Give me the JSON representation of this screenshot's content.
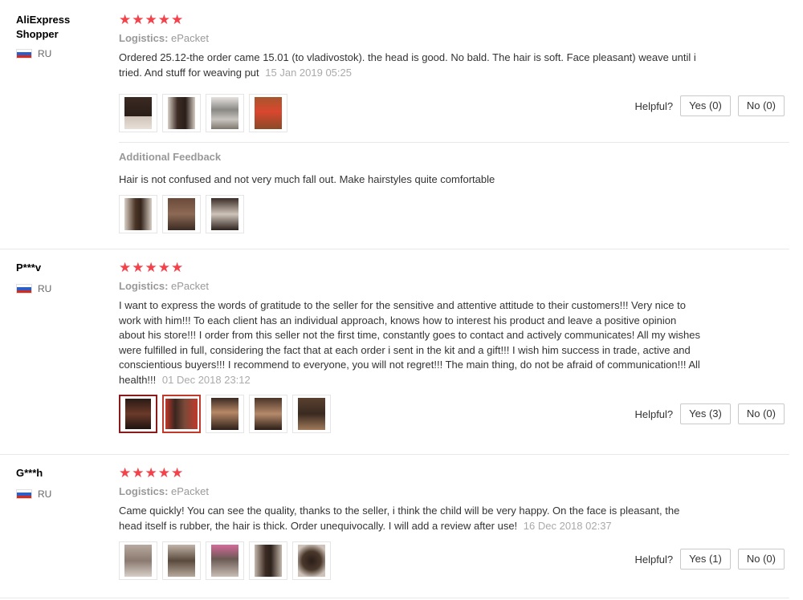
{
  "reviews": [
    {
      "user": "AliExpress\nShopper",
      "country": "RU",
      "stars": "★★★★★",
      "logistics_label": "Logistics:",
      "logistics_value": "ePacket",
      "text": "Ordered 25.12-the order came 15.01 (to vladivostok). the head is good. No bald. The hair is soft. Face pleasant) weave until i tried. And stuff for weaving put",
      "date": "15 Jan 2019 05:25",
      "helpful_label": "Helpful?",
      "yes": "Yes (0)",
      "no": "No (0)",
      "photo_count": 4,
      "additional": {
        "title": "Additional Feedback",
        "text": "Hair is not confused and not very much fall out. Make hairstyles quite comfortable",
        "photo_count": 3
      }
    },
    {
      "user": "P***v",
      "country": "RU",
      "stars": "★★★★★",
      "logistics_label": "Logistics:",
      "logistics_value": "ePacket",
      "text": "I want to express the words of gratitude to the seller for the sensitive and attentive attitude to their customers!!! Very nice to work with him!!! To each client has an individual approach, knows how to interest his product and leave a positive opinion about his store!!! I order from this seller not the first time, constantly goes to contact and actively communicates! All my wishes were fulfilled in full, considering the fact that at each order i sent in the kit and a gift!!! I wish him success in trade, active and conscientious buyers!!! I recommend to everyone, you will not regret!!! The main thing, do not be afraid of communication!!! All health!!!",
      "date": "01 Dec 2018 23:12",
      "helpful_label": "Helpful?",
      "yes": "Yes (3)",
      "no": "No (0)",
      "photo_count": 5
    },
    {
      "user": "G***h",
      "country": "RU",
      "stars": "★★★★★",
      "logistics_label": "Logistics:",
      "logistics_value": "ePacket",
      "text": "Came quickly! You can see the quality, thanks to the seller, i think the child will be very happy. On the face is pleasant, the head itself is rubber, the hair is thick. Order unequivocally. I will add a review after use!",
      "date": "16 Dec 2018 02:37",
      "helpful_label": "Helpful?",
      "yes": "Yes (1)",
      "no": "No (0)",
      "photo_count": 5
    }
  ],
  "colors": {
    "star": "#f4424a",
    "flag_white": "#ffffff",
    "flag_blue": "#2b5fc7",
    "flag_red": "#d52b1e"
  },
  "icons": [
    "star-icon",
    "russia-flag-icon",
    "photo-thumbnail"
  ]
}
